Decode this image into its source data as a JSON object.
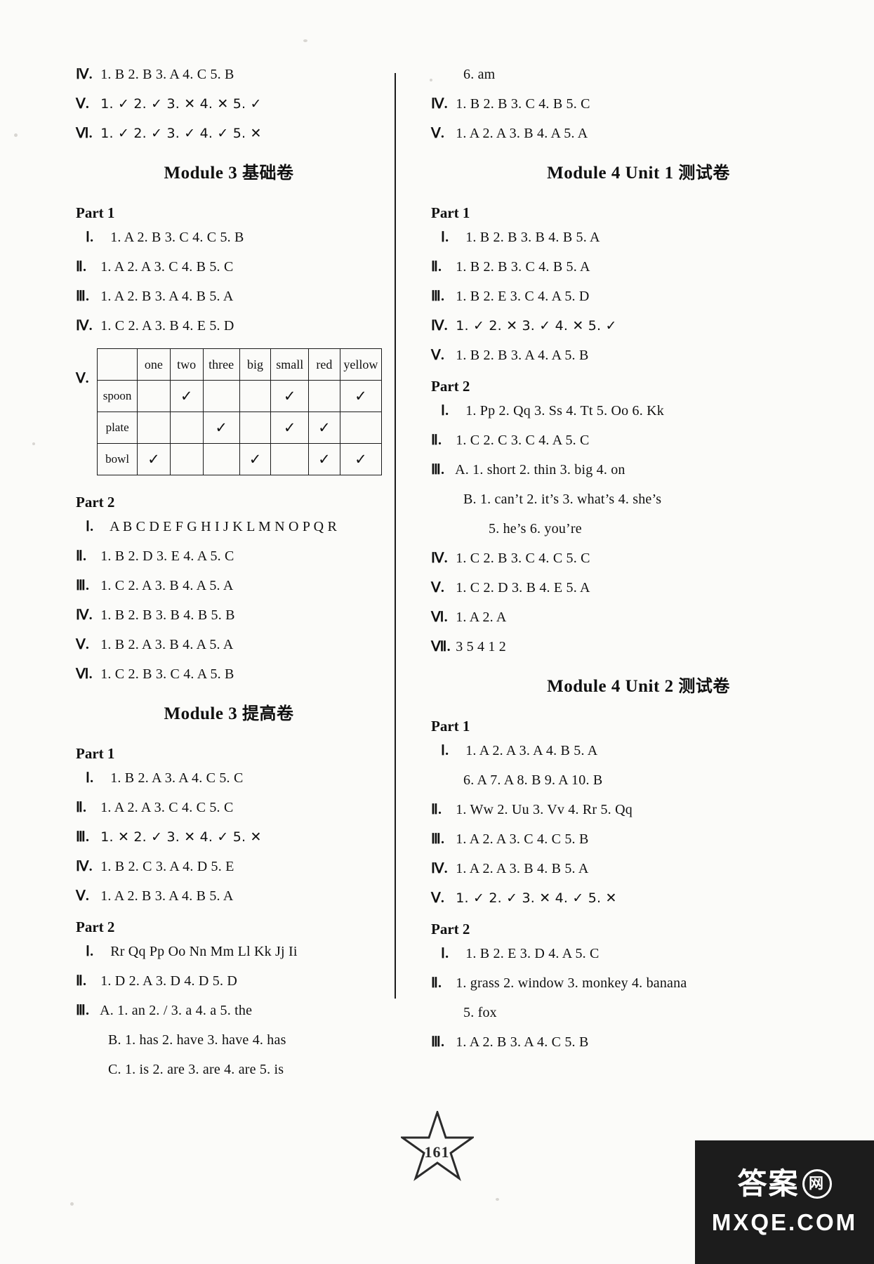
{
  "page": {
    "number": "161",
    "watermark_cn": "答案",
    "watermark_circle": "网",
    "watermark_latin": "MXQE.COM"
  },
  "left_column": {
    "top_answers": [
      {
        "rn": "Ⅳ.",
        "text": "1. B  2. B  3. A  4. C  5. B"
      },
      {
        "rn": "Ⅴ.",
        "text": "1. ✓  2. ✓  3. ✕  4. ✕  5. ✓"
      },
      {
        "rn": "Ⅵ.",
        "text": "1. ✓  2. ✓  3. ✓  4. ✓  5. ✕"
      }
    ],
    "section1": {
      "title_en": "Module 3 ",
      "title_cn": "基础卷",
      "part1_label": "Part 1",
      "part1_answers": [
        {
          "rn": "Ⅰ.",
          "text": "1. A   2. B  3. C  4. C  5. B"
        },
        {
          "rn": "Ⅱ.",
          "text": "1. A  2. A  3. C  4. B  5. C"
        },
        {
          "rn": "Ⅲ.",
          "text": "1. A  2. B  3. A  4. B  5. A"
        },
        {
          "rn": "Ⅳ.",
          "text": "1. C  2. A  3. B  4. E  5. D"
        }
      ],
      "table": {
        "label": "Ⅴ.",
        "columns": [
          "",
          "one",
          "two",
          "three",
          "big",
          "small",
          "red",
          "yellow"
        ],
        "rows": [
          {
            "head": "spoon",
            "marks": [
              "",
              "✓",
              "",
              "",
              "✓",
              "",
              "✓"
            ]
          },
          {
            "head": "plate",
            "marks": [
              "",
              "",
              "✓",
              "",
              "✓",
              "✓",
              ""
            ]
          },
          {
            "head": "bowl",
            "marks": [
              "✓",
              "",
              "",
              "✓",
              "",
              "✓",
              "✓"
            ]
          }
        ]
      },
      "part2_label": "Part 2",
      "part2_answers": [
        {
          "rn": "Ⅰ.",
          "text": "A B C D E F G H I J K L M N O P Q R"
        },
        {
          "rn": "Ⅱ.",
          "text": "1. B  2. D  3. E  4. A  5. C"
        },
        {
          "rn": "Ⅲ.",
          "text": "1. C  2. A  3. B  4. A  5. A"
        },
        {
          "rn": "Ⅳ.",
          "text": "1. B  2. B  3. B  4. B  5. B"
        },
        {
          "rn": "Ⅴ.",
          "text": "1. B  2. A  3. B  4. A  5. A"
        },
        {
          "rn": "Ⅵ.",
          "text": "1. C  2. B  3. C   4. A  5. B"
        }
      ]
    },
    "section2": {
      "title_en": "Module 3 ",
      "title_cn": "提高卷",
      "part1_label": "Part 1",
      "part1_answers": [
        {
          "rn": "Ⅰ.",
          "text": "1. B  2. A  3. A  4. C  5. C"
        },
        {
          "rn": "Ⅱ.",
          "text": "1. A  2. A  3. C  4. C  5. C"
        },
        {
          "rn": "Ⅲ.",
          "text": "1. ✕  2. ✓  3. ✕  4. ✓  5. ✕"
        },
        {
          "rn": "Ⅳ.",
          "text": "1. B  2. C  3. A  4. D  5. E"
        },
        {
          "rn": "Ⅴ.",
          "text": "1. A  2. B  3. A  4. B  5. A"
        }
      ],
      "part2_label": "Part 2",
      "part2_answers": [
        {
          "rn": "Ⅰ.",
          "text": "Rr  Qq  Pp  Oo  Nn  Mm  Ll  Kk  Jj  Ii"
        },
        {
          "rn": "Ⅱ.",
          "text": "1. D  2. A  3. D  4. D  5. D"
        },
        {
          "rn": "Ⅲ.",
          "text": "A. 1. an  2. /  3. a  4. a  5. the"
        },
        {
          "rn": "",
          "text": "B. 1. has  2. have  3. have  4. has",
          "indent": "sub"
        },
        {
          "rn": "",
          "text": "C. 1. is  2. are  3. are  4. are  5. is",
          "indent": "sub"
        }
      ]
    }
  },
  "right_column": {
    "top_answers": [
      {
        "rn": "",
        "text": "6. am",
        "indent": "sub"
      },
      {
        "rn": "Ⅳ.",
        "text": "1. B  2. B  3. C  4. B  5. C"
      },
      {
        "rn": "Ⅴ.",
        "text": "1. A  2. A  3. B  4. A  5. A"
      }
    ],
    "section1": {
      "title_en": "Module 4 Unit 1 ",
      "title_cn": "测试卷",
      "part1_label": "Part 1",
      "part1_answers": [
        {
          "rn": "Ⅰ.",
          "text": "1. B   2. B  3. B  4. B  5. A"
        },
        {
          "rn": "Ⅱ.",
          "text": "1. B  2. B  3. C  4. B  5. A"
        },
        {
          "rn": "Ⅲ.",
          "text": "1. B  2. E  3. C  4. A  5. D"
        },
        {
          "rn": "Ⅳ.",
          "text": "1. ✓  2. ✕  3. ✓  4. ✕  5. ✓"
        },
        {
          "rn": "Ⅴ.",
          "text": "1. B  2. B  3. A  4. A   5. B"
        }
      ],
      "part2_label": "Part 2",
      "part2_answers": [
        {
          "rn": "Ⅰ.",
          "text": "1. Pp  2. Qq  3. Ss  4. Tt  5. Oo  6. Kk"
        },
        {
          "rn": "Ⅱ.",
          "text": "1. C  2. C  3. C  4. A  5. C"
        },
        {
          "rn": "Ⅲ.",
          "text": "A. 1. short  2. thin  3. big  4. on"
        },
        {
          "rn": "",
          "text": "B. 1. can’t  2. it’s   3. what’s  4. she’s",
          "indent": "sub"
        },
        {
          "rn": "",
          "text": "5. he’s  6. you’re",
          "indent": "sub2"
        },
        {
          "rn": "Ⅳ.",
          "text": "1. C  2. B   3. C  4. C  5. C"
        },
        {
          "rn": "Ⅴ.",
          "text": "1. C  2. D  3. B  4. E  5. A"
        },
        {
          "rn": "Ⅵ.",
          "text": "1. A  2. A"
        },
        {
          "rn": "Ⅶ.",
          "text": "3 5 4 1 2"
        }
      ]
    },
    "section2": {
      "title_en": "Module 4 Unit 2 ",
      "title_cn": "测试卷",
      "part1_label": "Part 1",
      "part1_answers": [
        {
          "rn": "Ⅰ.",
          "text": "1. A  2. A  3. A  4. B  5. A"
        },
        {
          "rn": "",
          "text": "6. A  7. A  8. B  9. A  10. B",
          "indent": "sub"
        },
        {
          "rn": "Ⅱ.",
          "text": "1. Ww  2. Uu  3. Vv  4. Rr  5. Qq"
        },
        {
          "rn": "Ⅲ.",
          "text": "1. A  2. A  3. C  4. C  5. B"
        },
        {
          "rn": "Ⅳ.",
          "text": "1. A  2. A  3. B  4. B  5. A"
        },
        {
          "rn": "Ⅴ.",
          "text": "1. ✓  2. ✓  3. ✕  4. ✓  5. ✕"
        }
      ],
      "part2_label": "Part 2",
      "part2_answers": [
        {
          "rn": "Ⅰ.",
          "text": "1. B  2. E  3. D  4. A  5. C"
        },
        {
          "rn": "Ⅱ.",
          "text": "1. grass   2. window  3. monkey  4. banana"
        },
        {
          "rn": "",
          "text": "5. fox",
          "indent": "sub"
        },
        {
          "rn": "Ⅲ.",
          "text": "1. A  2. B  3. A  4. C  5. B"
        }
      ]
    }
  }
}
